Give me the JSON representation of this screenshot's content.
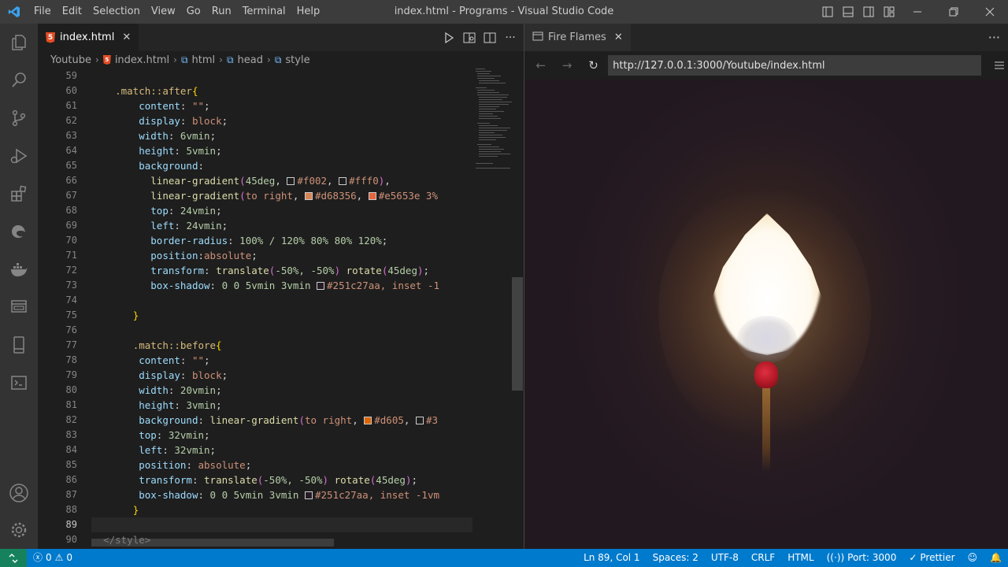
{
  "window": {
    "title": "index.html - Programs - Visual Studio Code",
    "menu": [
      "File",
      "Edit",
      "Selection",
      "View",
      "Go",
      "Run",
      "Terminal",
      "Help"
    ]
  },
  "activity_bar": [
    "explorer-icon",
    "search-icon",
    "source-control-icon",
    "run-debug-icon",
    "extensions-icon",
    "edge-icon",
    "docker-icon",
    "remote-explorer-icon",
    "device-icon",
    "terminal-icon",
    "accounts-icon",
    "settings-gear-icon"
  ],
  "editor": {
    "tab_label": "index.html",
    "tab_icon_text": "5",
    "breadcrumb": {
      "folder": "Youtube",
      "file": "index.html",
      "symbols": [
        "html",
        "head",
        "style"
      ]
    },
    "line_numbers": [
      "59",
      "60",
      "61",
      "62",
      "63",
      "64",
      "65",
      "66",
      "67",
      "68",
      "69",
      "70",
      "71",
      "72",
      "73",
      "74",
      "75",
      "76",
      "77",
      "78",
      "79",
      "80",
      "81",
      "82",
      "83",
      "84",
      "85",
      "86",
      "87",
      "88",
      "89",
      "90"
    ],
    "code": {
      "l60_sel": ".match::after",
      "l61_prop": "content",
      "l61_val": "\"\"",
      "l62_prop": "display",
      "l62_val": "block",
      "l63_prop": "width",
      "l63_val": "6vmin",
      "l64_prop": "height",
      "l64_val": "5vmin",
      "l65_prop": "background",
      "l66_fn": "linear-gradient",
      "l66_arg": "45deg",
      "l66_c1": "#f002",
      "l66_c2": "#fff0",
      "l67_fn": "linear-gradient",
      "l67_arg": "to right",
      "l67_c1": "#d68356",
      "l67_c2": "#e5653e 3%",
      "l68_prop": "top",
      "l68_val": "24vmin",
      "l69_prop": "left",
      "l69_val": "24vmin",
      "l70_prop": "border-radius",
      "l70_val": "100% / 120% 80% 80% 120%",
      "l71_prop": "position",
      "l71_val": "absolute",
      "l72_prop": "transform",
      "l72_fn1": "translate",
      "l72_args1": "-50%, -50%",
      "l72_fn2": "rotate",
      "l72_args2": "45deg",
      "l73_prop": "box-shadow",
      "l73_val": "0 0 5vmin 3vmin",
      "l73_c1": "#251c27aa, inset -1",
      "l77_sel": ".match::before",
      "l78_prop": "content",
      "l78_val": "\"\"",
      "l79_prop": "display",
      "l79_val": "block",
      "l80_prop": "width",
      "l80_val": "20vmin",
      "l81_prop": "height",
      "l81_val": "3vmin",
      "l82_prop": "background",
      "l82_fn": "linear-gradient",
      "l82_arg": "to right",
      "l82_c1": "#d605",
      "l82_c2": "#3",
      "l83_prop": "top",
      "l83_val": "32vmin",
      "l84_prop": "left",
      "l84_val": "32vmin",
      "l85_prop": "position",
      "l85_val": "absolute",
      "l86_prop": "transform",
      "l86_fn1": "translate",
      "l86_args1": "-50%, -50%",
      "l86_fn2": "rotate",
      "l86_args2": "45deg",
      "l87_prop": "box-shadow",
      "l87_val": "0 0 5vmin 3vmin",
      "l87_c1": "#251c27aa, inset -1vm",
      "l90_tag": "</style>"
    }
  },
  "browser": {
    "tab_label": "Fire Flames",
    "url": "http://127.0.0.1:3000/Youtube/index.html"
  },
  "statusbar": {
    "errors": "0",
    "warnings": "0",
    "cursor": "Ln 89, Col 1",
    "spaces": "Spaces: 2",
    "encoding": "UTF-8",
    "eol": "CRLF",
    "language": "HTML",
    "port": "Port: 3000",
    "prettier": "Prettier"
  },
  "colors": {
    "accent": "#007acc",
    "remote": "#16825d",
    "match_head": "#c01c2a",
    "swatch_d68356": "#d68356",
    "swatch_e5653e": "#e5653e",
    "swatch_d605": "#dd6600"
  }
}
